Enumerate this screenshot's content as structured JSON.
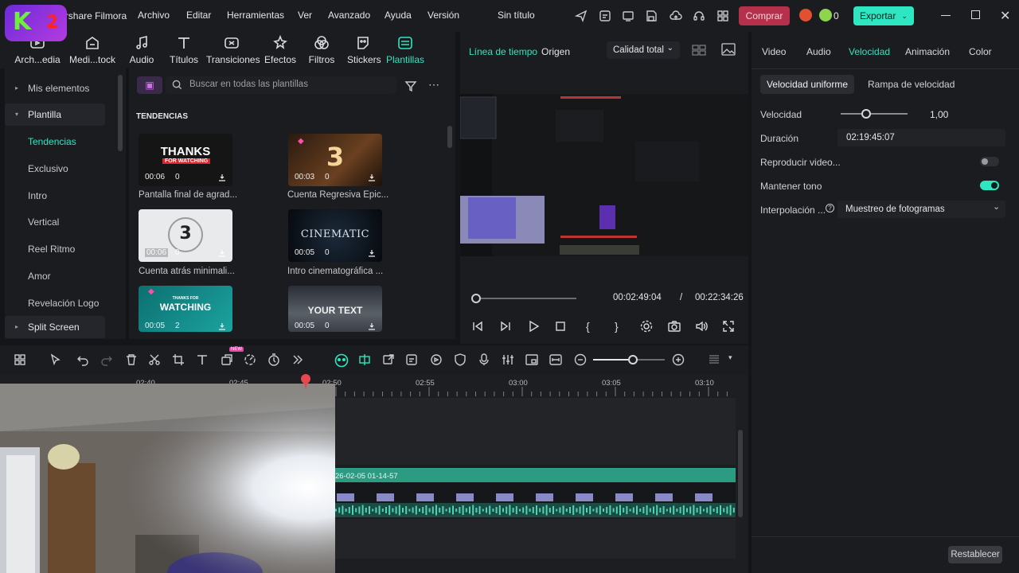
{
  "app": {
    "title": "Wondershare Filmora",
    "project_title": "Sin título",
    "menu": [
      "Archivo",
      "Editar",
      "Herramientas",
      "Ver",
      "Avanzado",
      "Ayuda",
      "Versión"
    ],
    "buy_label": "Comprar",
    "points": "0",
    "export_label": "Exportar",
    "accent": "#2ee6c1"
  },
  "toolbar": {
    "tabs": [
      {
        "label": "Arch...edia",
        "icon": "import-media-icon"
      },
      {
        "label": "Medi...tock",
        "icon": "stock-media-icon"
      },
      {
        "label": "Audio",
        "icon": "music-note-icon"
      },
      {
        "label": "Títulos",
        "icon": "text-icon"
      },
      {
        "label": "Transiciones",
        "icon": "transition-icon"
      },
      {
        "label": "Efectos",
        "icon": "effects-icon"
      },
      {
        "label": "Filtros",
        "icon": "filters-icon"
      },
      {
        "label": "Stickers",
        "icon": "sticker-icon"
      },
      {
        "label": "Plantillas",
        "icon": "templates-icon"
      }
    ],
    "active": "Plantillas"
  },
  "sidebar": {
    "items": [
      {
        "label": "Mis elementos",
        "arrow": "▸"
      },
      {
        "label": "Plantilla",
        "arrow": "▾"
      },
      {
        "label": "Tendencias"
      },
      {
        "label": "Exclusivo"
      },
      {
        "label": "Intro"
      },
      {
        "label": "Vertical"
      },
      {
        "label": "Reel Ritmo"
      },
      {
        "label": "Amor"
      },
      {
        "label": "Revelación Logo"
      },
      {
        "label": "Split Screen",
        "arrow": "▸"
      }
    ]
  },
  "templates": {
    "search_placeholder": "Buscar en todas las plantillas",
    "section_title": "TENDENCIAS",
    "items": [
      {
        "caption": "Pantalla final de agrad...",
        "duration": "00:06",
        "count": "0",
        "art_title": "THANKS",
        "art_sub": "FOR WATCHING"
      },
      {
        "caption": "Cuenta Regresiva Épic...",
        "duration": "00:03",
        "count": "0",
        "art_title": "3"
      },
      {
        "caption": "Cuenta atrás minimali...",
        "duration": "00:06",
        "count": "0",
        "art_title": "3"
      },
      {
        "caption": "Intro cinematográfica ...",
        "duration": "00:05",
        "count": "0",
        "art_title": "CINEMATIC"
      },
      {
        "caption": "",
        "duration": "00:05",
        "count": "2",
        "art_title": "WATCHING",
        "art_sub": "THANKS FOR"
      },
      {
        "caption": "",
        "duration": "00:05",
        "count": "0",
        "art_title": "YOUR TEXT"
      }
    ]
  },
  "preview": {
    "tab_timeline": "Línea de tiempo",
    "tab_source": "Origen",
    "quality": "Calidad total",
    "current_time": "00:02:49:04",
    "separator": "/",
    "total_time": "00:22:34:26",
    "progress": 0.0
  },
  "right_panel": {
    "tabs": [
      "Video",
      "Audio",
      "Velocidad",
      "Animación",
      "Color"
    ],
    "active_tab": "Velocidad",
    "subtabs": [
      "Velocidad uniforme",
      "Rampa de velocidad"
    ],
    "speed_label": "Velocidad",
    "speed_value": "1,00",
    "duration_label": "Duración",
    "duration_value": "02:19:45:07",
    "reverse_label": "Reproducir video...",
    "reverse_on": false,
    "keep_pitch_label": "Mantener tono",
    "keep_pitch_on": true,
    "interp_label": "Interpolación ...",
    "interp_value": "Muestreo de fotogramas",
    "reset_label": "Restablecer"
  },
  "timeline": {
    "ruler": [
      "02:40",
      "02:45",
      "02:50",
      "02:55",
      "03:00",
      "03:05",
      "03:10"
    ],
    "clip_label": "26-02-05 01-14-57",
    "new_badge": "NEW"
  }
}
